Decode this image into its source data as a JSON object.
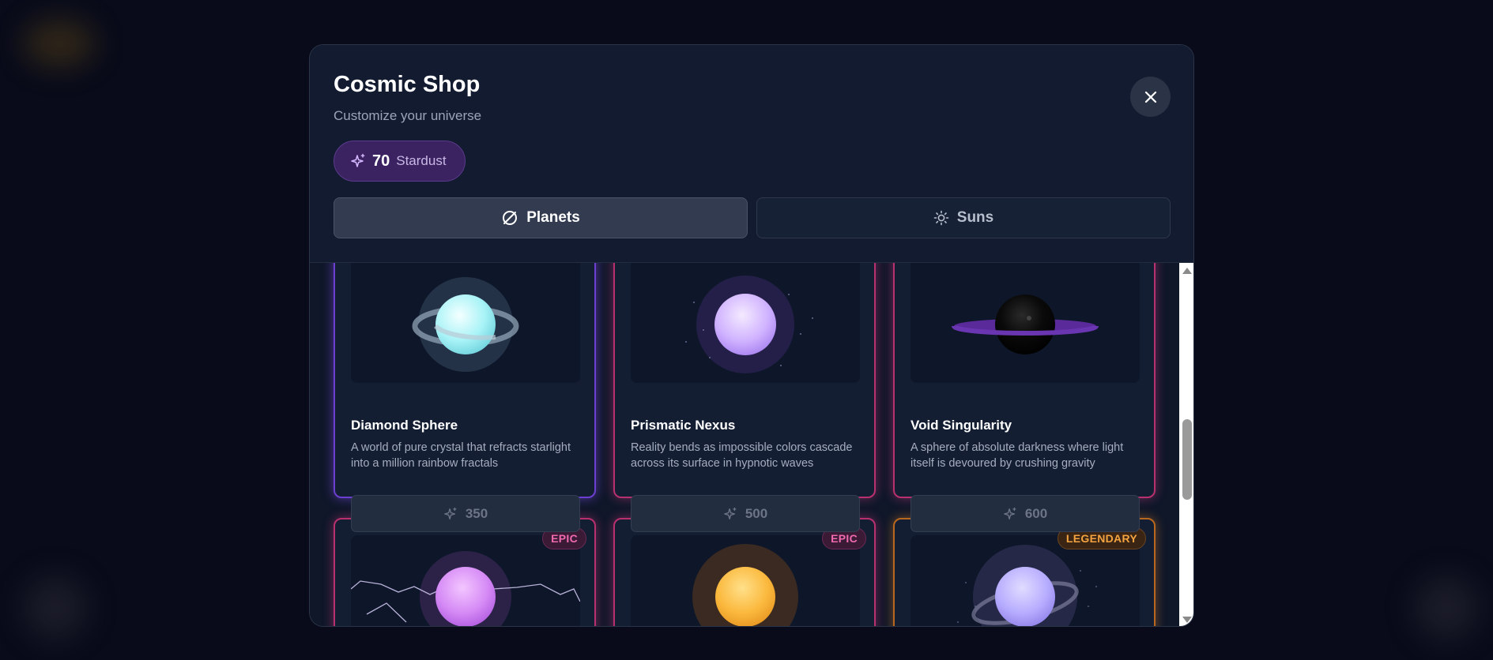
{
  "shop": {
    "title": "Cosmic Shop",
    "subtitle": "Customize your universe",
    "stardust_amount": "70",
    "stardust_label": "Stardust",
    "tabs": [
      {
        "label": "Planets",
        "icon": "planet-icon",
        "active": true
      },
      {
        "label": "Suns",
        "icon": "sun-icon",
        "active": false
      }
    ]
  },
  "items": [
    {
      "name": "Diamond Sphere",
      "description": "A world of pure crystal that refracts starlight into a million rainbow fractals",
      "price": "350",
      "rarity_color": "#6b3fd0"
    },
    {
      "name": "Prismatic Nexus",
      "description": "Reality bends as impossible colors cascade across its surface in hypnotic waves",
      "price": "500",
      "rarity_color": "#b8306e"
    },
    {
      "name": "Void Singularity",
      "description": "A sphere of absolute darkness where light itself is devoured by crushing gravity",
      "price": "600",
      "rarity_color": "#b8306e"
    },
    {
      "badge": "EPIC",
      "rarity_color": "#b8306e"
    },
    {
      "badge": "EPIC",
      "rarity_color": "#b8306e"
    },
    {
      "badge": "LEGENDARY",
      "rarity_color": "#b7671e"
    }
  ],
  "colors": {
    "accent": "#6b3fd0",
    "epic": "#f06ab0",
    "legendary": "#f3a340"
  }
}
